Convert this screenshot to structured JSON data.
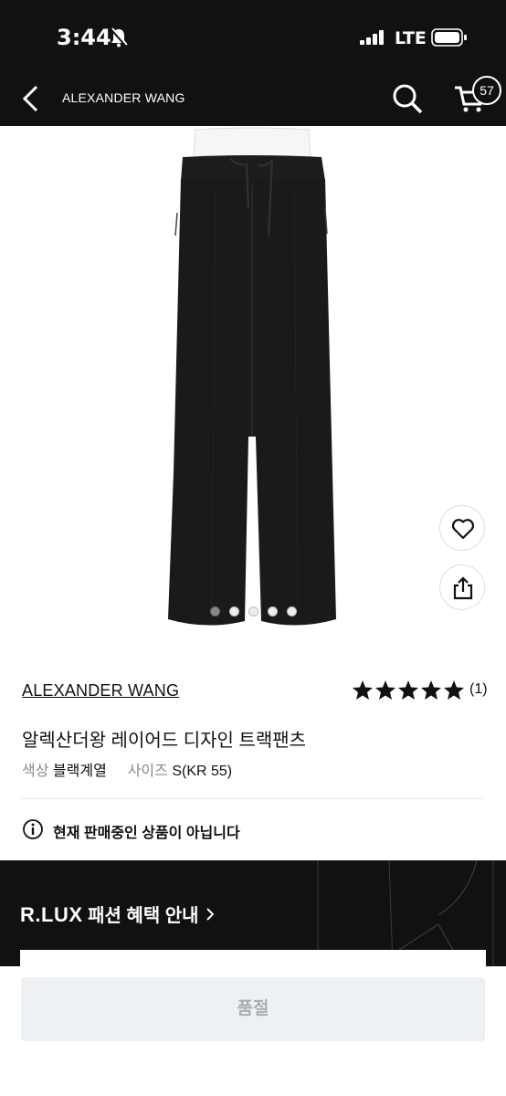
{
  "status_bar": {
    "time": "3:44",
    "network": "LTE"
  },
  "nav": {
    "title": "ALEXANDER WANG",
    "cart_count": "57"
  },
  "gallery": {
    "total_images": 5,
    "active_index": 0
  },
  "product": {
    "brand": "ALEXANDER WANG",
    "rating": 5,
    "review_count": "(1)",
    "name": "알렉산더왕 레이어드 디자인 트랙팬츠",
    "color_label": "색상",
    "color_value": "블랙계열",
    "size_label": "사이즈",
    "size_value": "S(KR 55)"
  },
  "notice": {
    "text": "현재 판매중인 상품이 아닙니다"
  },
  "banner": {
    "logo": "R.LUX",
    "text": "패션 혜택 안내"
  },
  "bottom": {
    "button_label": "품절"
  },
  "colors": {
    "dark": "#111111",
    "disabled_bg": "#eef1f4",
    "disabled_text": "#a8adb3"
  }
}
